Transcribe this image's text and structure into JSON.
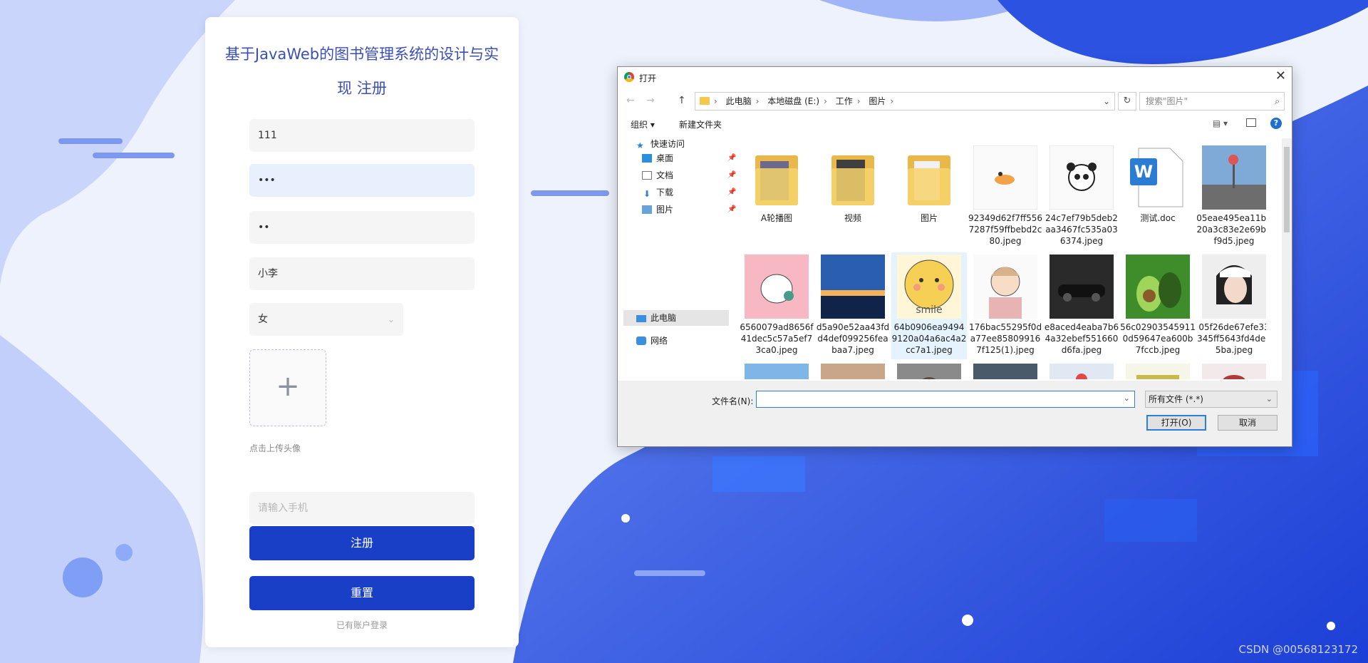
{
  "register": {
    "title": "基于JavaWeb的图书管理系统的设计与实现 注册",
    "username": "111",
    "password": "•••",
    "password_confirm": "••",
    "realname": "小李",
    "gender": "女",
    "upload_hint": "点击上传头像",
    "phone_placeholder": "请输入手机",
    "register_button": "注册",
    "reset_button": "重置",
    "login_link": "已有账户登录"
  },
  "dialog": {
    "title": "打开",
    "breadcrumbs": [
      "此电脑",
      "本地磁盘 (E:)",
      "工作",
      "图片"
    ],
    "search_placeholder": "搜索\"图片\"",
    "toolbar": {
      "organize": "组织 ▾",
      "new_folder": "新建文件夹",
      "help": "?"
    },
    "sidebar": {
      "quick_access": "快速访问",
      "items": [
        "桌面",
        "文档",
        "下载",
        "图片"
      ],
      "this_pc": "此电脑",
      "network": "网络"
    },
    "files": [
      {
        "name": "A轮播图",
        "type": "folder"
      },
      {
        "name": "视频",
        "type": "folder"
      },
      {
        "name": "图片",
        "type": "folder"
      },
      {
        "name": "92349d62f7ff5567287f59ffbebd2c80.jpeg",
        "type": "image"
      },
      {
        "name": "24c7ef79b5deb2aa3467fc535a036374.jpeg",
        "type": "image"
      },
      {
        "name": "测试.doc",
        "type": "doc"
      },
      {
        "name": "05eae495ea11b420a3c83e2e69b2f9d5.jpeg",
        "type": "image"
      },
      {
        "name": "6560079ad8656f41dec5c57a5ef73ca0.jpeg",
        "type": "image"
      },
      {
        "name": "d5a90e52aa43fdd4def099256feabaa7.jpeg",
        "type": "image"
      },
      {
        "name": "64b0906ea94949120a04a6ac4a2cc7a1.jpeg",
        "type": "image"
      },
      {
        "name": "176bac55295f0da77ee858099167f125(1).jpeg",
        "type": "image"
      },
      {
        "name": "e8aced4eaba7b64a32ebef551660d6fa.jpeg",
        "type": "image"
      },
      {
        "name": "56c029035459110d59647ea600b7fccb.jpeg",
        "type": "image"
      },
      {
        "name": "05f26de67efe33345ff5643fd4de65ba.jpeg",
        "type": "image"
      }
    ],
    "filename_label": "文件名(N):",
    "filename_value": "",
    "filetype": "所有文件 (*.*)",
    "open_button": "打开(O)",
    "cancel_button": "取消"
  },
  "watermark": "CSDN @00568123172"
}
